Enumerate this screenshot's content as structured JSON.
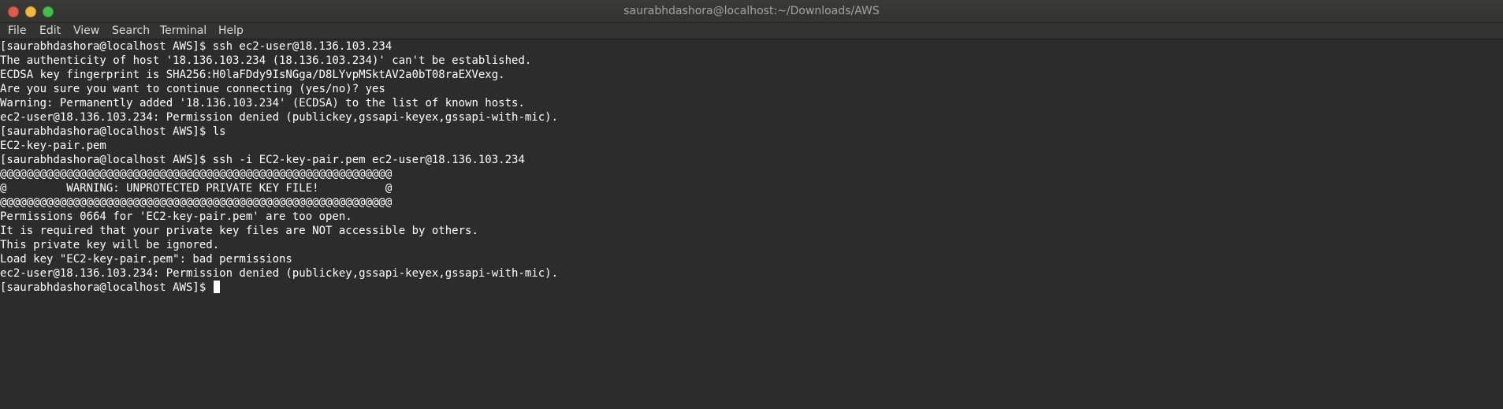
{
  "window": {
    "title": "saurabhdashora@localhost:~/Downloads/AWS"
  },
  "menu": {
    "items": [
      "File",
      "Edit",
      "View",
      "Search",
      "Terminal",
      "Help"
    ]
  },
  "terminal": {
    "lines": [
      "[saurabhdashora@localhost AWS]$ ssh ec2-user@18.136.103.234",
      "The authenticity of host '18.136.103.234 (18.136.103.234)' can't be established.",
      "ECDSA key fingerprint is SHA256:H0laFDdy9IsNGga/D8LYvpMSktAV2a0bT08raEXVexg.",
      "Are you sure you want to continue connecting (yes/no)? yes",
      "Warning: Permanently added '18.136.103.234' (ECDSA) to the list of known hosts.",
      "ec2-user@18.136.103.234: Permission denied (publickey,gssapi-keyex,gssapi-with-mic).",
      "[saurabhdashora@localhost AWS]$ ls",
      "EC2-key-pair.pem",
      "[saurabhdashora@localhost AWS]$ ssh -i EC2-key-pair.pem ec2-user@18.136.103.234",
      "@@@@@@@@@@@@@@@@@@@@@@@@@@@@@@@@@@@@@@@@@@@@@@@@@@@@@@@@@@@",
      "@         WARNING: UNPROTECTED PRIVATE KEY FILE!          @",
      "@@@@@@@@@@@@@@@@@@@@@@@@@@@@@@@@@@@@@@@@@@@@@@@@@@@@@@@@@@@",
      "Permissions 0664 for 'EC2-key-pair.pem' are too open.",
      "It is required that your private key files are NOT accessible by others.",
      "This private key will be ignored.",
      "Load key \"EC2-key-pair.pem\": bad permissions",
      "ec2-user@18.136.103.234: Permission denied (publickey,gssapi-keyex,gssapi-with-mic).",
      "[saurabhdashora@localhost AWS]$ "
    ]
  },
  "colors": {
    "background": "#2c2c2c",
    "text": "#ffffff",
    "close_button": "#e25a4b",
    "minimize_button": "#f2b93a",
    "maximize_button": "#41bf48"
  }
}
